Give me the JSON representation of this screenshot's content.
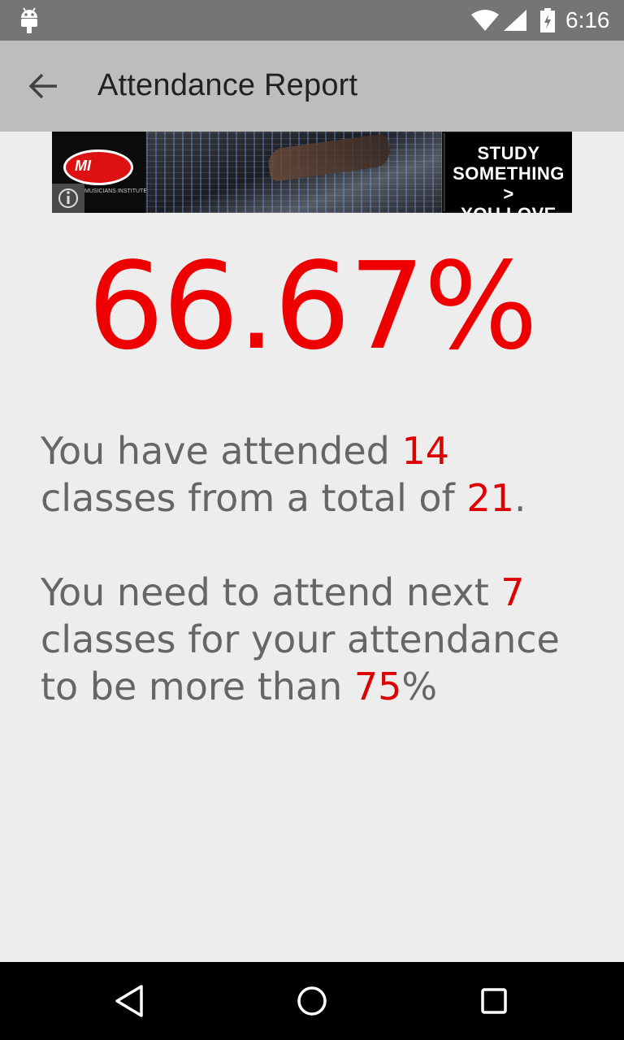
{
  "status_bar": {
    "time": "6:16",
    "icons": [
      "android-icon",
      "wifi-icon",
      "signal-icon",
      "battery-icon"
    ]
  },
  "app_bar": {
    "title": "Attendance Report",
    "back_icon": "arrow-back-icon"
  },
  "ad": {
    "logo_text": "MI",
    "brand_caption": "MUSICIANS INSTITUTE",
    "cta_lines": [
      "STUDY",
      "SOMETHING >",
      "YOU LOVE"
    ],
    "info_icon": "info-icon"
  },
  "report": {
    "percentage": "66.67%",
    "attended_prefix": "You have attended ",
    "attended_count": "14",
    "attended_middle": " classes from a total of ",
    "total_count": "21",
    "attended_suffix": ".",
    "need_prefix": "You need to attend next ",
    "need_count": "7",
    "need_middle": " classes for your attendance to be more than ",
    "target_percent": "75",
    "need_suffix": "%"
  },
  "nav_bar": {
    "icons": [
      "nav-back-icon",
      "nav-home-icon",
      "nav-recents-icon"
    ]
  },
  "colors": {
    "highlight": "#ee0000",
    "body_text": "#666666",
    "app_bar": "#bdbdbd",
    "status_bar": "#757575",
    "background": "#ededed"
  }
}
